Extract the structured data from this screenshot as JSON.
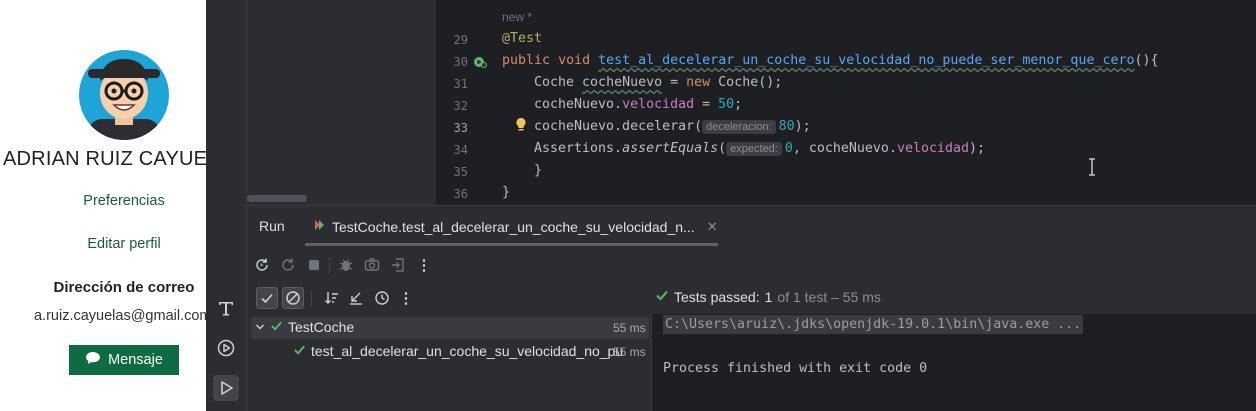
{
  "profile": {
    "name": "ADRIAN RUIZ CAYUELAS",
    "preferences_link": "Preferencias",
    "edit_profile_link": "Editar perfil",
    "email_title": "Dirección de correo",
    "email": "a.ruiz.cayuelas@gmail.com",
    "message_button": "Mensaje"
  },
  "editor": {
    "author_hint": "new *",
    "line_numbers": [
      "29",
      "30",
      "31",
      "32",
      "33",
      "34",
      "35",
      "36"
    ],
    "line29_annotation": "@Test",
    "line30_public": "public",
    "line30_void": "void",
    "line30_method": "test_al_decelerar_un_coche_su_velocidad_no_puede_ser_menor_que_cero",
    "line30_tail": "(){",
    "line31_type": "Coche ",
    "line31_var": "cocheNuevo",
    "line31_eq": " = ",
    "line31_new": "new",
    "line31_tail": " Coche();",
    "line32_obj": "cocheNuevo.",
    "line32_field": "velocidad",
    "line32_eq": " = ",
    "line32_num": "50",
    "line32_semi": ";",
    "line33_call": "cocheNuevo.decelerar(",
    "line33_hint": "deceleracion:",
    "line33_num": "80",
    "line33_tail": ");",
    "line34_head": "Assertions.",
    "line34_method": "assertEquals",
    "line34_paren": "(",
    "line34_hint": "expected:",
    "line34_num": "0",
    "line34_mid": ", cocheNuevo.",
    "line34_field": "velocidad",
    "line34_tail": ");",
    "line35": "}",
    "line36": "}"
  },
  "run": {
    "panel_title": "Run",
    "tab_label": "TestCoche.test_al_decelerar_un_coche_su_velocidad_n...",
    "status_label": "Tests passed:",
    "status_count": "1",
    "status_rest": "of 1 test – 55 ms",
    "tree": [
      {
        "name": "TestCoche",
        "duration": "55 ms"
      },
      {
        "name": "test_al_decelerar_un_coche_su_velocidad_no_pu",
        "duration": "55 ms"
      }
    ],
    "console": {
      "command": "C:\\Users\\aruiz\\.jdks\\openjdk-19.0.1\\bin\\java.exe ...",
      "exit": "Process finished with exit code 0"
    }
  },
  "colors": {
    "accent_green": "#0f6b42",
    "pass_green": "#5fb865",
    "ide_bg": "#1e1f22"
  }
}
